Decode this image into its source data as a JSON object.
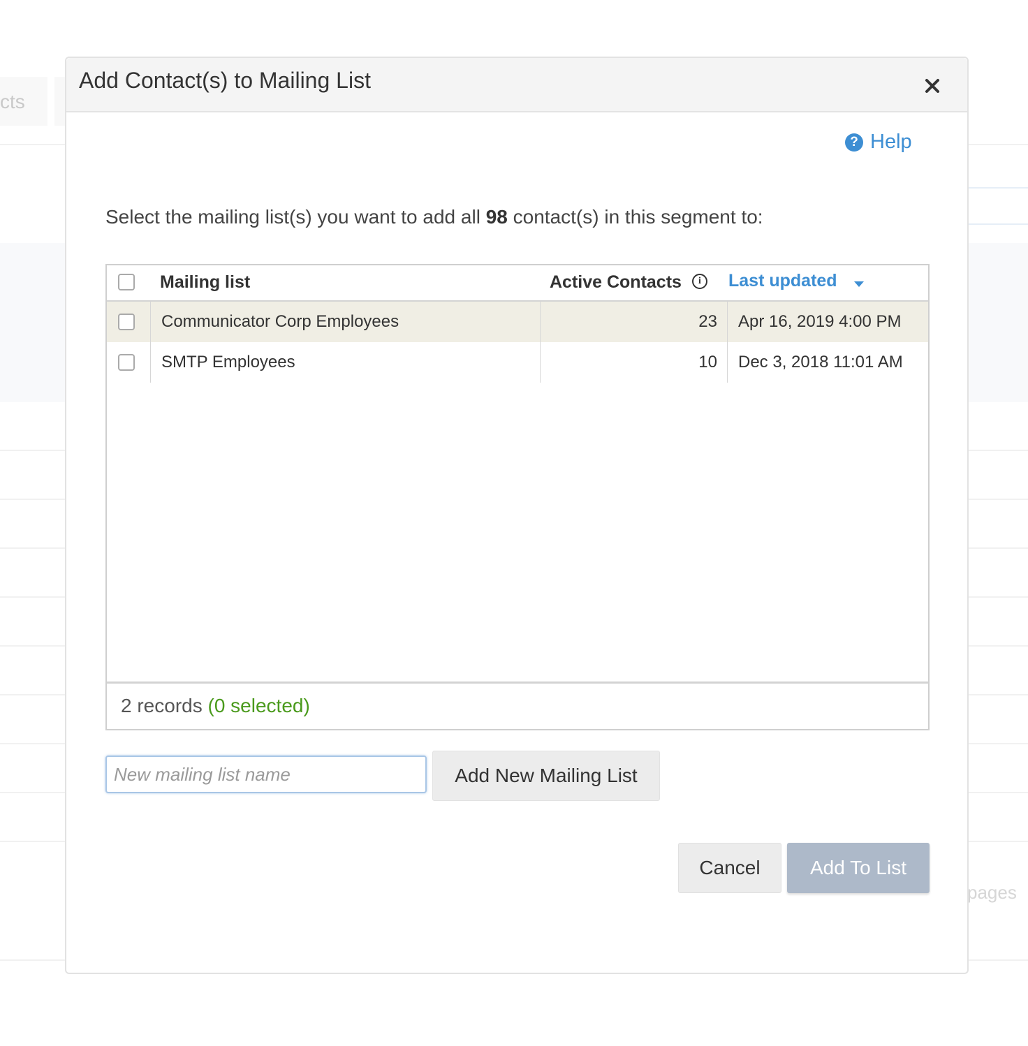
{
  "background": {
    "tab_fragment": "cts",
    "pages_fragment": "pages"
  },
  "modal": {
    "title": "Add Contact(s) to Mailing List",
    "close_icon": "close-icon",
    "help": {
      "icon": "question-circle-icon",
      "label": "Help"
    },
    "instruction": {
      "before": "Select the mailing list(s) you want to add all ",
      "count": "98",
      "after": " contact(s) in this segment to:"
    },
    "table": {
      "columns": {
        "name": "Mailing list",
        "active_contacts": "Active Contacts",
        "last_updated": "Last updated"
      },
      "rows": [
        {
          "name": "Communicator Corp Employees",
          "active_contacts": "23",
          "last_updated": "Apr 16, 2019 4:00 PM",
          "highlighted": true
        },
        {
          "name": "SMTP Employees",
          "active_contacts": "10",
          "last_updated": "Dec 3, 2018 11:01 AM",
          "highlighted": false
        }
      ],
      "footer": {
        "records": "2 records",
        "selected": "(0 selected)"
      }
    },
    "new_list": {
      "placeholder": "New mailing list name",
      "value": "",
      "button_label": "Add New Mailing List"
    },
    "buttons": {
      "cancel": "Cancel",
      "add_to_list": "Add To List"
    },
    "colors": {
      "link": "#3d8ed3",
      "selected_text": "#4a9a1c",
      "highlight_row": "#f0eee4",
      "disabled_primary": "#adb9c9"
    }
  }
}
